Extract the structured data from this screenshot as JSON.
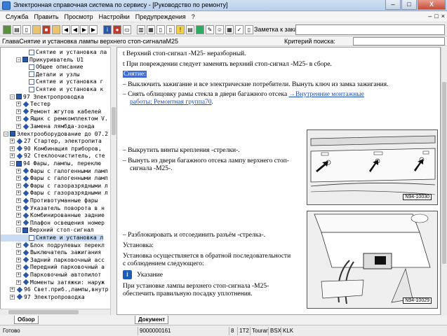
{
  "window": {
    "title": "Электронная справочная система по сервису - [Руководство по ремонту]",
    "controls": {
      "minimize": "–",
      "maximize": "□",
      "close": "X"
    }
  },
  "menu": {
    "items": [
      "Служба",
      "Править",
      "Просмотр",
      "Настройки",
      "Предупреждения",
      "?"
    ],
    "doc_controls": [
      "–",
      "□",
      "×"
    ]
  },
  "toolbar": {
    "icons": [
      "book-icon",
      "print-icon",
      "document-icon",
      "folder-icon",
      "stop-icon",
      "folder-open-icon",
      "first-icon",
      "prev-icon",
      "next-icon",
      "last-icon",
      "info-icon",
      "stop-red-icon",
      "car-icon",
      "book2-icon",
      "calculator-icon",
      "page-icon",
      "doc-icon",
      "warning-icon",
      "chart-icon",
      "color-icon",
      "tool-icon",
      "person-icon",
      "puzzle-icon",
      "check-icon",
      "document2-icon",
      "mail-icon",
      "exit-icon"
    ],
    "order_label": "Заметка к заказу:",
    "order_value": ""
  },
  "address": {
    "path": "ГлаваСнятие и установка лампы верхнего стоп-сигналаM25",
    "criteria_label": "Критерий поиска:",
    "criteria_value": ""
  },
  "tree": {
    "rows": [
      {
        "label": "Снятие и установка ла",
        "indent": 4,
        "exp": "",
        "icon": "doc"
      },
      {
        "label": "Прикуриватель U1",
        "indent": 2,
        "exp": "−",
        "icon": "book"
      },
      {
        "label": "Общее описание",
        "indent": 4,
        "exp": "",
        "icon": "doc"
      },
      {
        "label": "Детали и узлы",
        "indent": 4,
        "exp": "",
        "icon": "doc"
      },
      {
        "label": "Снятие и установка г",
        "indent": 4,
        "exp": "",
        "icon": "doc"
      },
      {
        "label": "Снятие и установка к",
        "indent": 4,
        "exp": "",
        "icon": "doc"
      },
      {
        "label": "97 Электропроводка",
        "indent": 1,
        "exp": "−",
        "icon": "book"
      },
      {
        "label": "Тестер",
        "indent": 2,
        "exp": "+",
        "icon": "diamond"
      },
      {
        "label": "Ремонт жгутов кабелей",
        "indent": 2,
        "exp": "+",
        "icon": "diamond"
      },
      {
        "label": "Ящик с ремкомплектом V.",
        "indent": 2,
        "exp": "+",
        "icon": "diamond"
      },
      {
        "label": "Замена лямбда-зонда",
        "indent": 2,
        "exp": "+",
        "icon": "diamond"
      },
      {
        "label": "Электрооборудование до 07.2",
        "indent": 0,
        "exp": "−",
        "icon": "book"
      },
      {
        "label": "27 Стартер, электропита",
        "indent": 1,
        "exp": "+",
        "icon": "diamond"
      },
      {
        "label": "90 Комбинация приборов,",
        "indent": 1,
        "exp": "+",
        "icon": "diamond"
      },
      {
        "label": "92 Стеклоочиститель, сте",
        "indent": 1,
        "exp": "+",
        "icon": "diamond"
      },
      {
        "label": "94 Фары, лампы, переклю",
        "indent": 1,
        "exp": "−",
        "icon": "book"
      },
      {
        "label": "Фары с галогенными ламп",
        "indent": 2,
        "exp": "+",
        "icon": "diamond"
      },
      {
        "label": "Фары с галогенными ламп",
        "indent": 2,
        "exp": "+",
        "icon": "diamond"
      },
      {
        "label": "Фары с газоразрядными л",
        "indent": 2,
        "exp": "+",
        "icon": "diamond"
      },
      {
        "label": "Фары с газоразрядными л",
        "indent": 2,
        "exp": "+",
        "icon": "diamond"
      },
      {
        "label": "Противотуманные фары",
        "indent": 2,
        "exp": "+",
        "icon": "diamond"
      },
      {
        "label": "Указатель поворота в н",
        "indent": 2,
        "exp": "+",
        "icon": "diamond"
      },
      {
        "label": "Комбинированные задние",
        "indent": 2,
        "exp": "+",
        "icon": "diamond"
      },
      {
        "label": "Плафон освещения номер",
        "indent": 2,
        "exp": "+",
        "icon": "diamond"
      },
      {
        "label": "Верхний стоп-сигнал",
        "indent": 2,
        "exp": "−",
        "icon": "book"
      },
      {
        "label": "Снятие и установка л",
        "indent": 4,
        "exp": "",
        "icon": "doc",
        "selected": true
      },
      {
        "label": "Блок подрулевых перекл",
        "indent": 2,
        "exp": "+",
        "icon": "diamond"
      },
      {
        "label": "Выключатель зажигания",
        "indent": 2,
        "exp": "+",
        "icon": "diamond"
      },
      {
        "label": "Задний парковочный асс",
        "indent": 2,
        "exp": "+",
        "icon": "diamond"
      },
      {
        "label": "Передний парковочный а",
        "indent": 2,
        "exp": "+",
        "icon": "diamond"
      },
      {
        "label": "Парковочный автопилот",
        "indent": 2,
        "exp": "+",
        "icon": "diamond"
      },
      {
        "label": "Моменты затяжки: наруж",
        "indent": 2,
        "exp": "+",
        "icon": "diamond"
      },
      {
        "label": "96 Свет.приб.,лампы,внутр",
        "indent": 1,
        "exp": "+",
        "icon": "diamond"
      },
      {
        "label": "97 Электропроводка",
        "indent": 1,
        "exp": "+",
        "icon": "diamond"
      }
    ]
  },
  "tabs_left": {
    "overview": "Обзор"
  },
  "tabs_right": {
    "document": "Документ"
  },
  "content": {
    "line1": "t  Верхний стоп-сигнал -M25- неразборный.",
    "line2": "t  При повреждении следует заменять верхний стоп-сигнал -M25- в сборе.",
    "removal_header": "Снятие:",
    "step1": "–  Выключить зажигание и все электрические потребители. Вынуть ключ из замка зажигания.",
    "step2_text": "–  Снять облицовку рамы стекла в двери багажного отсека ",
    "step2_link1": "→Внутренние монтажные",
    "step2_link2": "работы; Ремонтная группа70",
    "step2_end": ".",
    "step3": "–  Выкрутить винты крепления -стрелки-.",
    "step4a": "–  Вынуть из двери багажного отсека лампу верхнего стоп-",
    "step4b": "сигнала -M25-.",
    "step5": "–  Разблокировать и отсоединить разъём -стрелка-.",
    "install_header": "Установка:",
    "install_a": "Установка осуществляется в обратной последовательности",
    "install_b": "с соблюдением следующего:",
    "hint_label": "Указание",
    "hint_a": "При установке лампы верхнего стоп-сигнала -M25-",
    "hint_b": "обеспечить правильную посадку уплотнения.",
    "figure1_label": "N94-10030",
    "figure2_label": "N94-10029"
  },
  "status": {
    "ready": "Готово",
    "code": "9000000161",
    "num": "8",
    "t": "1T2",
    "model": "Touran",
    "bsx": "BSX",
    "klk": "KLK"
  }
}
